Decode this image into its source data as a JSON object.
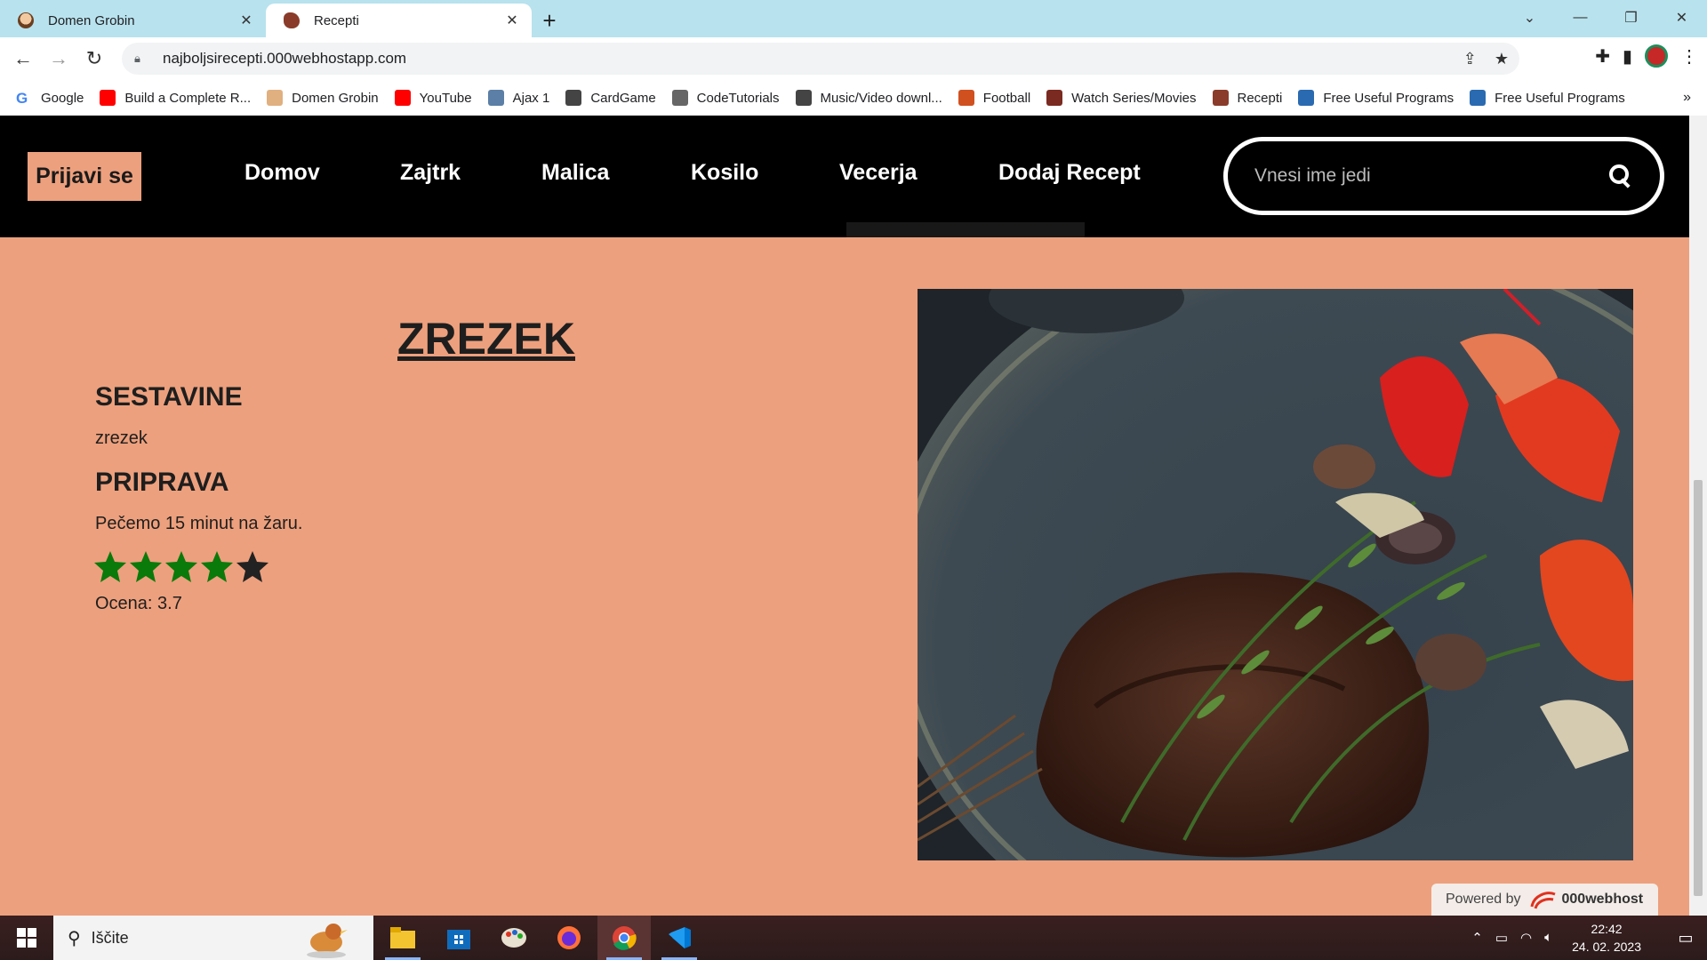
{
  "browser": {
    "tabs": [
      {
        "title": "Domen Grobin",
        "active": false
      },
      {
        "title": "Recepti",
        "active": true
      }
    ],
    "url": "najboljsirecepti.000webhostapp.com",
    "bookmarks": [
      {
        "label": "Google",
        "icon": "google-icon"
      },
      {
        "label": "Build a Complete R...",
        "icon": "youtube-icon"
      },
      {
        "label": "Domen Grobin",
        "icon": "avatar-icon"
      },
      {
        "label": "YouTube",
        "icon": "youtube-icon"
      },
      {
        "label": "Ajax 1",
        "icon": "monitor-icon"
      },
      {
        "label": "CardGame",
        "icon": "cards-icon"
      },
      {
        "label": "CodeTutorials",
        "icon": "book-icon"
      },
      {
        "label": "Music/Video downl...",
        "icon": "film-icon"
      },
      {
        "label": "Football",
        "icon": "person-icon"
      },
      {
        "label": "Watch Series/Movies",
        "icon": "tv-icon"
      },
      {
        "label": "Recepti",
        "icon": "steak-icon"
      },
      {
        "label": "Free Useful Programs",
        "icon": "app-icon"
      },
      {
        "label": "Free Useful Programs",
        "icon": "app-icon"
      }
    ],
    "more": "»"
  },
  "site": {
    "login_label": "Prijavi se",
    "menu": [
      "Domov",
      "Zajtrk",
      "Malica",
      "Kosilo",
      "Vecerja",
      "Dodaj Recept"
    ],
    "search_placeholder": "Vnesi ime jedi"
  },
  "recipe": {
    "title": "ZREZEK",
    "ingredients_heading": "SESTAVINE",
    "ingredients": "zrezek",
    "preparation_heading": "PRIPRAVA",
    "preparation": "Pečemo 15 minut na žaru.",
    "rating_stars_filled": 4,
    "rating_stars_total": 5,
    "rating_text": "Ocena: 3.7",
    "star_color": "#0a7a0a",
    "star_empty_color": "#222222"
  },
  "footer": {
    "powered_by": "Powered by",
    "host": "000webhost"
  },
  "taskbar": {
    "search_label": "Iščite",
    "apps": [
      "file-explorer-icon",
      "store-icon",
      "paint-icon",
      "firefox-icon",
      "chrome-icon",
      "vscode-icon"
    ],
    "time": "22:42",
    "date": "24. 02. 2023"
  },
  "colors": {
    "page_bg": "#eda07d",
    "nav_bg": "#000000",
    "tabbar_bg": "#b8e2ee"
  }
}
